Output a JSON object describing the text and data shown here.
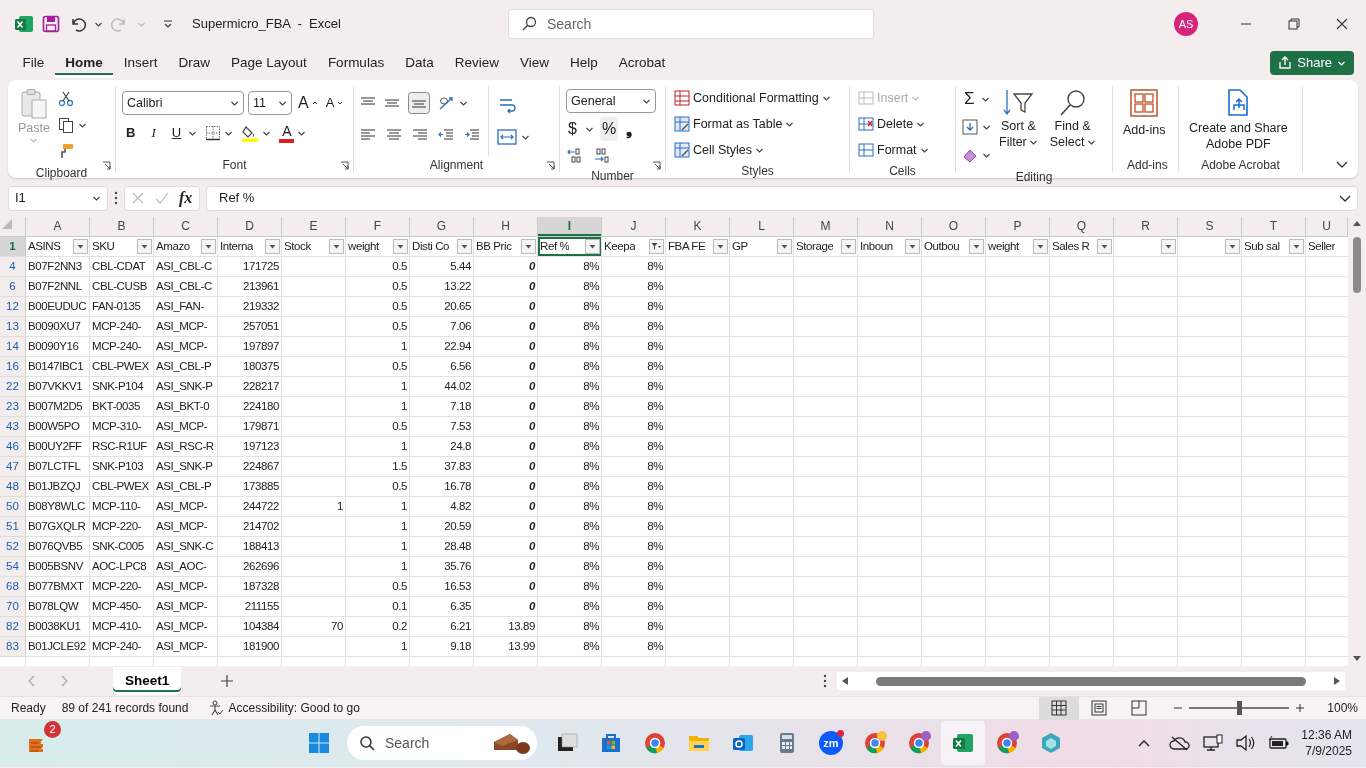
{
  "title_bar": {
    "title": "Supermicro_FBA  -  Excel",
    "search_placeholder": "Search",
    "avatar": "AS"
  },
  "ribbon_tabs": [
    {
      "label": "File",
      "selected": false
    },
    {
      "label": "Home",
      "selected": true
    },
    {
      "label": "Insert",
      "selected": false
    },
    {
      "label": "Draw",
      "selected": false
    },
    {
      "label": "Page Layout",
      "selected": false
    },
    {
      "label": "Formulas",
      "selected": false
    },
    {
      "label": "Data",
      "selected": false
    },
    {
      "label": "Review",
      "selected": false
    },
    {
      "label": "View",
      "selected": false
    },
    {
      "label": "Help",
      "selected": false
    },
    {
      "label": "Acrobat",
      "selected": false
    }
  ],
  "share": "Share",
  "ribbon": {
    "clipboard": {
      "paste": "Paste",
      "label": "Clipboard"
    },
    "font": {
      "name": "Calibri",
      "size": "11",
      "grow": "A",
      "shrink": "A",
      "bold": "B",
      "italic": "I",
      "underline": "U",
      "color_letter": "A",
      "label": "Font"
    },
    "alignment": {
      "label": "Alignment"
    },
    "number": {
      "format": "General",
      "currency": "$",
      "percent": "%",
      "comma": "❟",
      "label": "Number"
    },
    "styles": {
      "items": [
        "Conditional Formatting",
        "Format as Table",
        "Cell Styles"
      ],
      "label": "Styles"
    },
    "cells": {
      "items": [
        {
          "label": "Insert",
          "disabled": true
        },
        {
          "label": "Delete",
          "disabled": false
        },
        {
          "label": "Format",
          "disabled": false
        }
      ],
      "label": "Cells"
    },
    "editing": {
      "sum": "Σ",
      "sort": [
        "Sort &",
        "Filter"
      ],
      "find": [
        "Find &",
        "Select"
      ],
      "label": "Editing"
    },
    "addins": {
      "button": "Add-ins",
      "label": "Add-ins"
    },
    "acrobat": {
      "button": [
        "Create and Share",
        "Adobe PDF"
      ],
      "label": "Adobe Acrobat"
    }
  },
  "formula_bar": {
    "name_box": "I1",
    "fx": "fx",
    "formula": "Ref %"
  },
  "sheet": {
    "header_row": {
      "number": "1",
      "selected": true
    },
    "columns": [
      {
        "letter": "A",
        "header": "ASINS",
        "filtered": false,
        "selected": false
      },
      {
        "letter": "B",
        "header": "SKU",
        "filtered": false,
        "selected": false
      },
      {
        "letter": "C",
        "header": "Amazo",
        "filtered": false,
        "selected": false
      },
      {
        "letter": "D",
        "header": "Interna",
        "filtered": false,
        "selected": false
      },
      {
        "letter": "E",
        "header": "Stock",
        "filtered": false,
        "selected": false
      },
      {
        "letter": "F",
        "header": "weight",
        "filtered": false,
        "selected": false
      },
      {
        "letter": "G",
        "header": "Disti Co",
        "filtered": false,
        "selected": false
      },
      {
        "letter": "H",
        "header": "BB Pric",
        "filtered": false,
        "selected": false
      },
      {
        "letter": "I",
        "header": "Ref %",
        "filtered": false,
        "selected": true
      },
      {
        "letter": "J",
        "header": "Keepa",
        "filtered": true,
        "selected": false
      },
      {
        "letter": "K",
        "header": "FBA FE",
        "filtered": false,
        "selected": false
      },
      {
        "letter": "L",
        "header": "GP",
        "filtered": false,
        "selected": false
      },
      {
        "letter": "M",
        "header": "Storage",
        "filtered": false,
        "selected": false
      },
      {
        "letter": "N",
        "header": "Inboun",
        "filtered": false,
        "selected": false
      },
      {
        "letter": "O",
        "header": "Outbou",
        "filtered": false,
        "selected": false
      },
      {
        "letter": "P",
        "header": "weight",
        "filtered": false,
        "selected": false
      },
      {
        "letter": "Q",
        "header": "Sales R",
        "filtered": false,
        "selected": false
      },
      {
        "letter": "R",
        "filtered": false,
        "selected": false
      },
      {
        "letter": "S",
        "filtered": false,
        "selected": false
      },
      {
        "letter": "T",
        "header": "Sub sal",
        "filtered": false,
        "selected": false
      },
      {
        "letter": "U",
        "header": "Seller",
        "selected": false
      }
    ],
    "rows": [
      {
        "number": "4",
        "cells": {
          "A": "B07F2NN3",
          "B": "CBL-CDAT",
          "C": "ASI_CBL-C",
          "D": "171725",
          "F": "0.5",
          "G": "5.44",
          "H": "0",
          "I": "8%",
          "J": "8%"
        },
        "price_flagged": true
      },
      {
        "number": "6",
        "cells": {
          "A": "B07F2NNL",
          "B": "CBL-CUSB",
          "C": "ASI_CBL-C",
          "D": "213961",
          "F": "0.5",
          "G": "13.22",
          "H": "0",
          "I": "8%",
          "J": "8%"
        },
        "price_flagged": true
      },
      {
        "number": "12",
        "cells": {
          "A": "B00EUDUC",
          "B": "FAN-0135",
          "C": "ASI_FAN-",
          "D": "219332",
          "F": "0.5",
          "G": "20.65",
          "H": "0",
          "I": "8%",
          "J": "8%"
        },
        "price_flagged": true
      },
      {
        "number": "13",
        "cells": {
          "A": "B0090XU7",
          "B": "MCP-240-",
          "C": "ASI_MCP-",
          "D": "257051",
          "F": "0.5",
          "G": "7.06",
          "H": "0",
          "I": "8%",
          "J": "8%"
        },
        "price_flagged": true
      },
      {
        "number": "14",
        "cells": {
          "A": "B0090Y16",
          "B": "MCP-240-",
          "C": "ASI_MCP-",
          "D": "197897",
          "F": "1",
          "G": "22.94",
          "H": "0",
          "I": "8%",
          "J": "8%"
        },
        "price_flagged": true
      },
      {
        "number": "16",
        "cells": {
          "A": "B0147IBC1",
          "B": "CBL-PWEX",
          "C": "ASI_CBL-P",
          "D": "180375",
          "F": "0.5",
          "G": "6.56",
          "H": "0",
          "I": "8%",
          "J": "8%"
        },
        "price_flagged": true
      },
      {
        "number": "22",
        "cells": {
          "A": "B07VKKV1",
          "B": "SNK-P104",
          "C": "ASI_SNK-P",
          "D": "228217",
          "F": "1",
          "G": "44.02",
          "H": "0",
          "I": "8%",
          "J": "8%"
        },
        "price_flagged": true
      },
      {
        "number": "23",
        "cells": {
          "A": "B007M2D5",
          "B": "BKT-0035",
          "C": "ASI_BKT-0",
          "D": "224180",
          "F": "1",
          "G": "7.18",
          "H": "0",
          "I": "8%",
          "J": "8%"
        },
        "price_flagged": true
      },
      {
        "number": "43",
        "cells": {
          "A": "B00W5PO",
          "B": "MCP-310-",
          "C": "ASI_MCP-",
          "D": "179871",
          "F": "0.5",
          "G": "7.53",
          "H": "0",
          "I": "8%",
          "J": "8%"
        },
        "price_flagged": true
      },
      {
        "number": "46",
        "cells": {
          "A": "B00UY2FF",
          "B": "RSC-R1UF",
          "C": "ASI_RSC-R",
          "D": "197123",
          "F": "1",
          "G": "24.8",
          "H": "0",
          "I": "8%",
          "J": "8%"
        },
        "price_flagged": true
      },
      {
        "number": "47",
        "cells": {
          "A": "B07LCTFL",
          "B": "SNK-P103",
          "C": "ASI_SNK-P",
          "D": "224867",
          "F": "1.5",
          "G": "37.83",
          "H": "0",
          "I": "8%",
          "J": "8%"
        },
        "price_flagged": true
      },
      {
        "number": "48",
        "cells": {
          "A": "B01JBZQJ",
          "B": "CBL-PWEX",
          "C": "ASI_CBL-P",
          "D": "173885",
          "F": "0.5",
          "G": "16.78",
          "H": "0",
          "I": "8%",
          "J": "8%"
        },
        "price_flagged": true
      },
      {
        "number": "50",
        "cells": {
          "A": "B08Y8WLC",
          "B": "MCP-110-",
          "C": "ASI_MCP-",
          "D": "244722",
          "E": "1",
          "F": "1",
          "G": "4.82",
          "H": "0",
          "I": "8%",
          "J": "8%"
        },
        "price_flagged": true
      },
      {
        "number": "51",
        "cells": {
          "A": "B07GXQLR",
          "B": "MCP-220-",
          "C": "ASI_MCP-",
          "D": "214702",
          "F": "1",
          "G": "20.59",
          "H": "0",
          "I": "8%",
          "J": "8%"
        },
        "price_flagged": true
      },
      {
        "number": "52",
        "cells": {
          "A": "B076QVB5",
          "B": "SNK-C005",
          "C": "ASI_SNK-C",
          "D": "188413",
          "F": "1",
          "G": "28.48",
          "H": "0",
          "I": "8%",
          "J": "8%"
        },
        "price_flagged": true
      },
      {
        "number": "54",
        "cells": {
          "A": "B005BSNV",
          "B": "AOC-LPC8",
          "C": "ASI_AOC-",
          "D": "262696",
          "F": "1",
          "G": "35.76",
          "H": "0",
          "I": "8%",
          "J": "8%"
        },
        "price_flagged": true
      },
      {
        "number": "68",
        "cells": {
          "A": "B077BMXT",
          "B": "MCP-220-",
          "C": "ASI_MCP-",
          "D": "187328",
          "F": "0.5",
          "G": "16.53",
          "H": "0",
          "I": "8%",
          "J": "8%"
        },
        "price_flagged": true
      },
      {
        "number": "70",
        "cells": {
          "A": "B078LQW",
          "B": "MCP-450-",
          "C": "ASI_MCP-",
          "D": "211155",
          "F": "0.1",
          "G": "6.35",
          "H": "0",
          "I": "8%",
          "J": "8%"
        },
        "price_flagged": true
      },
      {
        "number": "82",
        "cells": {
          "A": "B0038KU1",
          "B": "MCP-410-",
          "C": "ASI_MCP-",
          "D": "104384",
          "E": "70",
          "F": "0.2",
          "G": "6.21",
          "H": "13.89",
          "I": "8%",
          "J": "8%"
        },
        "price_flagged": false
      },
      {
        "number": "83",
        "cells": {
          "A": "B01JCLE92",
          "B": "MCP-240-",
          "C": "ASI_MCP-",
          "D": "181900",
          "F": "1",
          "G": "9.18",
          "H": "13.99",
          "I": "8%",
          "J": "8%"
        },
        "price_flagged": false
      }
    ]
  },
  "sheet_tabs": [
    {
      "label": "Sheet1",
      "selected": true
    }
  ],
  "status_bar": {
    "mode": "Ready",
    "records": "89 of 241 records found",
    "accessibility": "Accessibility: Good to go",
    "views": [
      {
        "kind": "normal",
        "selected": true
      },
      {
        "kind": "page_layout",
        "selected": false
      },
      {
        "kind": "page_break",
        "selected": false
      }
    ],
    "zoom": {
      "level": 0.5,
      "reading": "100%"
    }
  },
  "taskbar": {
    "widget_badge": "2",
    "search_placeholder": "Search",
    "zoom_label": "zm",
    "time": "12:36 AM",
    "date": "7/9/2025"
  }
}
